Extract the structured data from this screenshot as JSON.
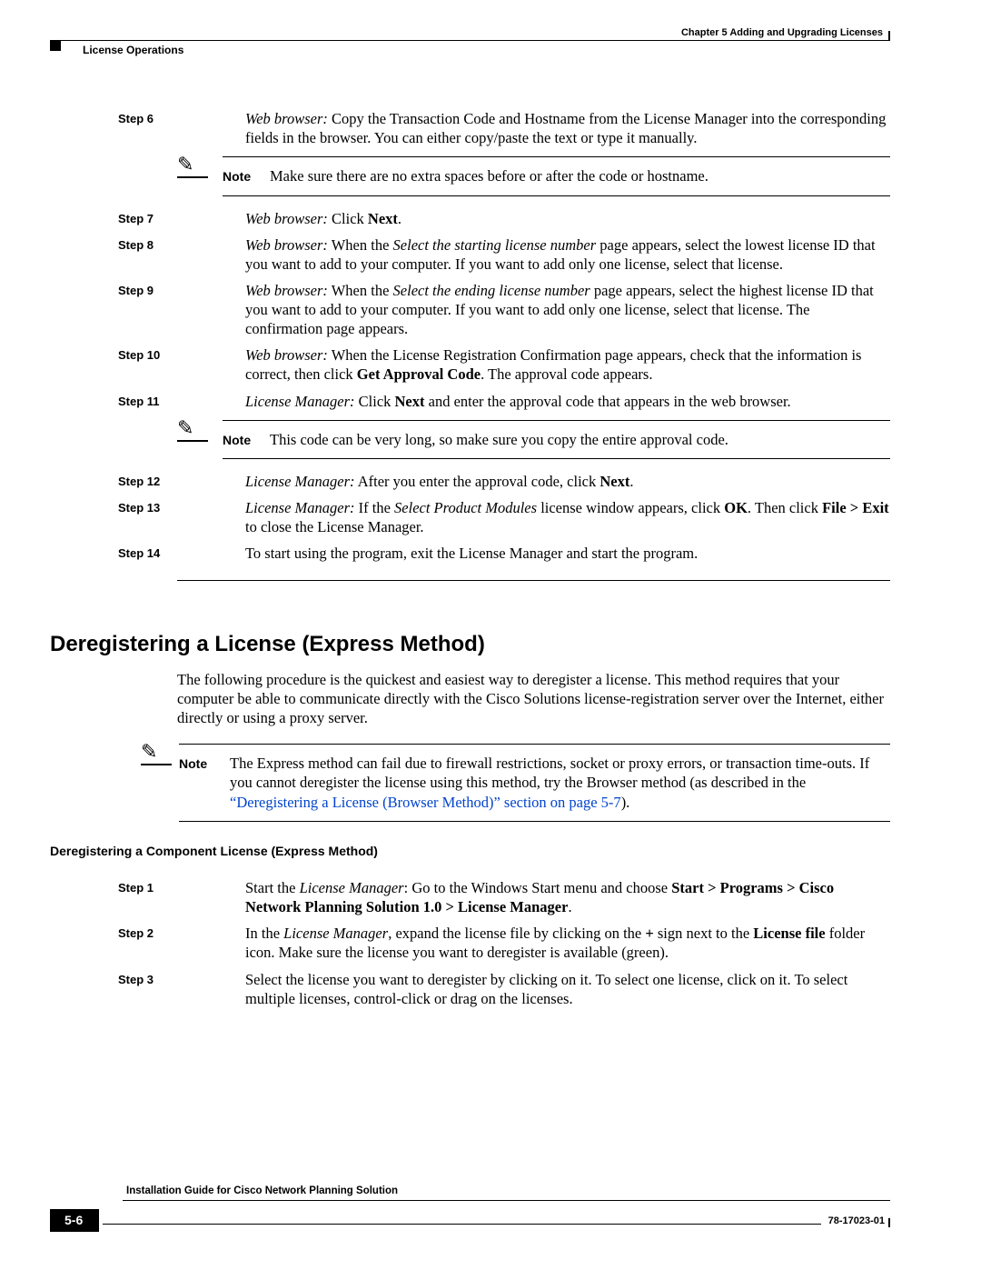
{
  "header": {
    "chapter": "Chapter 5      Adding and Upgrading Licenses",
    "section": "License Operations"
  },
  "steps_a": [
    {
      "n": "Step 6",
      "prefix": "Web browser:",
      "body": " Copy the Transaction Code and Hostname from the License Manager into the corresponding fields in the browser. You can either copy/paste the text or type it manually."
    }
  ],
  "note1": "Make sure there are no extra spaces before or after the code or hostname.",
  "steps_b": [
    {
      "n": "Step 7",
      "prefix": "Web browser:",
      "body_pre": " Click ",
      "bold1": "Next",
      "body_post": "."
    },
    {
      "n": "Step 8",
      "prefix": "Web browser:",
      "body_pre": " When the ",
      "ital1": "Select the starting license number",
      "body_post": " page appears, select the lowest license ID that you want to add to your computer. If you want to add only one license, select that license."
    },
    {
      "n": "Step 9",
      "prefix": "Web browser:",
      "body_pre": " When the ",
      "ital1": "Select the ending license number",
      "body_post": " page appears, select the highest license ID that you want to add to your computer. If you want to add only one license, select that license. The confirmation page appears."
    },
    {
      "n": "Step 10",
      "prefix": "Web browser:",
      "body_pre": " When the License Registration Confirmation page appears, check that the information is correct, then click ",
      "bold1": "Get Approval Code",
      "body_post": ". The approval code appears."
    },
    {
      "n": "Step 11",
      "prefix": "License Manager:",
      "body_pre": " Click ",
      "bold1": "Next",
      "body_post": " and enter the approval code that appears in the web browser."
    }
  ],
  "note2": "This code can be very long, so make sure you copy the entire approval code.",
  "steps_c": [
    {
      "n": "Step 12",
      "prefix": "License Manager:",
      "body_pre": " After you enter the approval code, click ",
      "bold1": "Next",
      "body_post": "."
    },
    {
      "n": "Step 13",
      "prefix": "License Manager:",
      "body_pre": " If the ",
      "ital1": "Select Product Modules",
      "mid": " license window appears, click ",
      "bold1": "OK",
      "mid2": ". Then click ",
      "bold2": "File > Exit",
      "body_post": " to close the License Manager."
    },
    {
      "n": "Step 14",
      "prefix": "",
      "body_pre": "To start using the program, exit the License Manager and start the program."
    }
  ],
  "h2": "Deregistering a License (Express Method)",
  "para1": "The following procedure is the quickest and easiest way to deregister a license. This method requires that your computer be able to communicate directly with the Cisco Solutions license-registration server over the Internet, either directly or using a proxy server.",
  "note3_pre": "The Express method can fail due to firewall restrictions, socket or proxy errors, or transaction time-outs. If you cannot deregister the license using this method, try the Browser method (as described in the ",
  "note3_link": "“Deregistering a License (Browser Method)” section on page 5-7",
  "note3_post": ").",
  "sub_h": "Deregistering a Component License (Express Method)",
  "steps_d": [
    {
      "n": "Step 1",
      "body_pre": "Start the ",
      "ital1": "License Manager",
      "mid": ": Go to the Windows Start menu and choose ",
      "bold1": "Start > Programs > Cisco Network Planning Solution 1.0 > License Manager",
      "body_post": "."
    },
    {
      "n": "Step 2",
      "body_pre": "In the ",
      "ital1": "License Manager",
      "mid": ", expand the license file by clicking on the ",
      "bold1": "+",
      "mid2": " sign next to the ",
      "bold2": "License file",
      "body_post": " folder icon. Make sure the license you want to deregister is available (green)."
    },
    {
      "n": "Step 3",
      "body_pre": "Select the license you want to deregister by clicking on it. To select one license, click on it. To select multiple licenses, control-click or drag on the licenses."
    }
  ],
  "footer": {
    "title": "Installation Guide for Cisco Network Planning Solution",
    "page": "5-6",
    "docnum": "78-17023-01"
  }
}
